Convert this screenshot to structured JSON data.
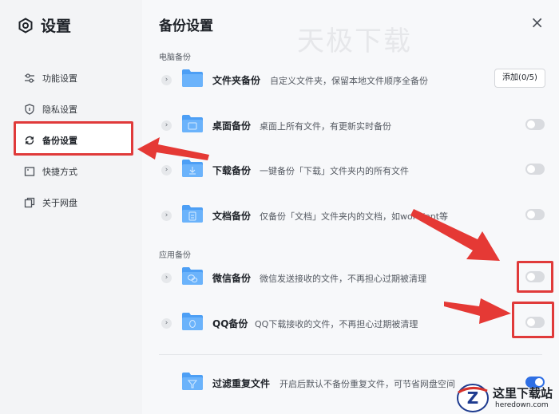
{
  "sidebar": {
    "title": "设置",
    "items": [
      {
        "label": "功能设置",
        "icon": "sliders-icon"
      },
      {
        "label": "隐私设置",
        "icon": "shield-icon"
      },
      {
        "label": "备份设置",
        "icon": "sync-icon"
      },
      {
        "label": "快捷方式",
        "icon": "shortcut-icon"
      },
      {
        "label": "关于网盘",
        "icon": "copy-icon"
      }
    ]
  },
  "main": {
    "title": "备份设置",
    "watermark": "天极下载",
    "close_label": "×",
    "sections": {
      "pc": "电脑备份",
      "app": "应用备份"
    },
    "rows": [
      {
        "title": "文件夹备份",
        "desc": "自定义文件夹，保留本地文件顺序全备份",
        "action": "添加(0/5)"
      },
      {
        "title": "桌面备份",
        "desc": "桌面上所有文件，有更新实时备份",
        "toggle": false
      },
      {
        "title": "下载备份",
        "desc": "一键备份「下载」文件夹内的所有文件",
        "toggle": false
      },
      {
        "title": "文档备份",
        "desc": "仅备份「文档」文件夹内的文档，如word/ppt等",
        "toggle": false
      },
      {
        "title": "微信备份",
        "desc": "微信发送接收的文件，不再担心过期被清理",
        "toggle": false
      },
      {
        "title": "QQ备份",
        "desc": "QQ下载接收的文件，不再担心过期被清理",
        "toggle": false
      },
      {
        "title": "过滤重复文件",
        "desc": "开启后默认不备份重复文件，可节省网盘空间",
        "toggle": true
      }
    ]
  },
  "logo": {
    "name": "这里下载站",
    "domain": "heredown.com",
    "letter": "Z"
  },
  "colors": {
    "accent": "#2f6fe4",
    "highlight": "#e03a3a",
    "folder": "#4d9ff5"
  }
}
